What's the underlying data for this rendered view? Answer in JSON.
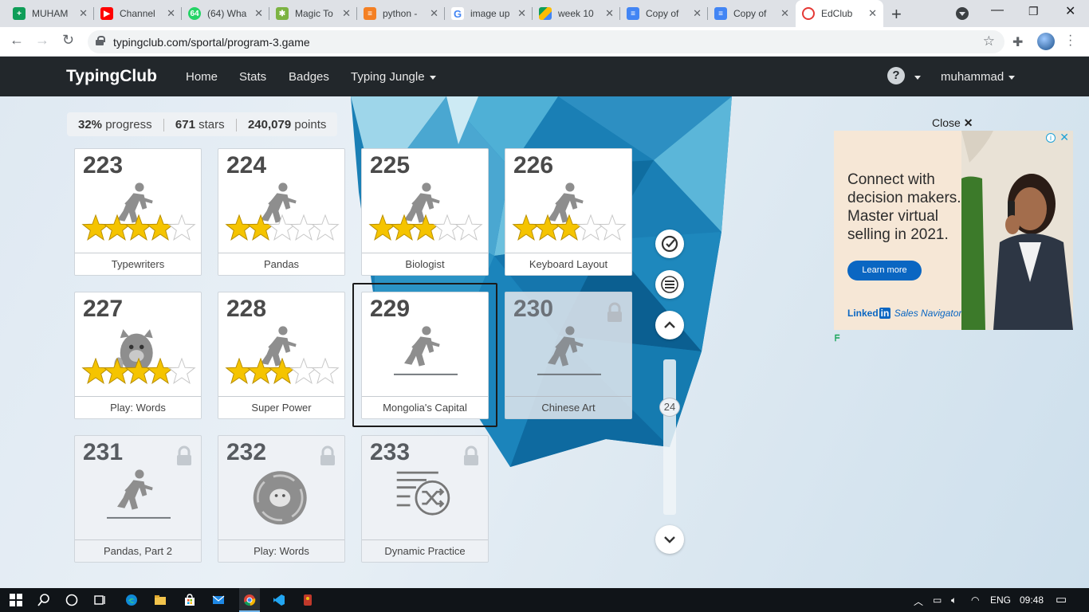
{
  "browser": {
    "tabs": [
      {
        "title": "MUHAM",
        "icon": "google-sheets-icon",
        "color": "#0f9d58"
      },
      {
        "title": "Channel",
        "icon": "youtube-icon",
        "color": "#ff0000"
      },
      {
        "title": "(64) Wha",
        "icon": "whatsapp-icon",
        "color": "#25d366",
        "badge": "64"
      },
      {
        "title": "Magic To",
        "icon": "magic-toolbox-icon",
        "color": "#7cb342"
      },
      {
        "title": "python -",
        "icon": "stackoverflow-icon",
        "color": "#f48024"
      },
      {
        "title": "image up",
        "icon": "google-icon",
        "color": "#4285f4"
      },
      {
        "title": "week 10",
        "icon": "google-drive-icon",
        "color": "#fbbc04"
      },
      {
        "title": "Copy of",
        "icon": "google-docs-icon",
        "color": "#4285f4"
      },
      {
        "title": "Copy of",
        "icon": "google-docs-icon",
        "color": "#4285f4"
      },
      {
        "title": "EdClub",
        "icon": "edclub-icon",
        "color": "#e53935"
      }
    ],
    "url": "typingclub.com/sportal/program-3.game"
  },
  "nav": {
    "brand": "TypingClub",
    "links": [
      "Home",
      "Stats",
      "Badges",
      "Typing Jungle"
    ],
    "help": "?",
    "user": "muhammad"
  },
  "progress": {
    "percent": "32%",
    "percent_label": "progress",
    "stars": "671",
    "stars_label": "stars",
    "points": "240,079",
    "points_label": "points"
  },
  "lessons": [
    {
      "num": "223",
      "title": "Typewriters",
      "art": "runner",
      "stars": 4,
      "state": "done"
    },
    {
      "num": "224",
      "title": "Pandas",
      "art": "runner",
      "stars": 2,
      "state": "done"
    },
    {
      "num": "225",
      "title": "Biologist",
      "art": "runner",
      "stars": 3,
      "state": "done"
    },
    {
      "num": "226",
      "title": "Keyboard Layout",
      "art": "runner",
      "stars": 3,
      "state": "done"
    },
    {
      "num": "227",
      "title": "Play: Words",
      "art": "monster",
      "stars": 4,
      "state": "done"
    },
    {
      "num": "228",
      "title": "Super Power",
      "art": "runner",
      "stars": 3,
      "state": "done"
    },
    {
      "num": "229",
      "title": "Mongolia's Capital",
      "art": "runner",
      "stars": 0,
      "state": "current"
    },
    {
      "num": "230",
      "title": "Chinese Art",
      "art": "runner",
      "stars": 0,
      "state": "dim-locked"
    },
    {
      "num": "231",
      "title": "Pandas, Part 2",
      "art": "runner",
      "stars": 0,
      "state": "locked"
    },
    {
      "num": "232",
      "title": "Play: Words",
      "art": "game-ball",
      "stars": 0,
      "state": "locked"
    },
    {
      "num": "233",
      "title": "Dynamic Practice",
      "art": "shuffle-list",
      "stars": 0,
      "state": "locked"
    }
  ],
  "side_controls": {
    "check_icon": "check-circle-icon",
    "menu_icon": "hamburger-icon",
    "up_icon": "chevron-up-icon",
    "down_icon": "chevron-down-icon",
    "scroll_position": "24"
  },
  "ad": {
    "close_label": "Close",
    "headline": "Connect with decision makers. Master virtual selling in 2021.",
    "cta": "Learn more",
    "brand_prefix": "Linked",
    "brand_in": "in",
    "brand_product": "Sales Navigator"
  },
  "taskbar": {
    "language": "ENG",
    "time": "09:48"
  },
  "colors": {
    "nav_bg": "#22272b",
    "star_gold": "#f5c400",
    "ice_blue": "#1a7fb5",
    "linkedin_blue": "#0a66c2"
  }
}
